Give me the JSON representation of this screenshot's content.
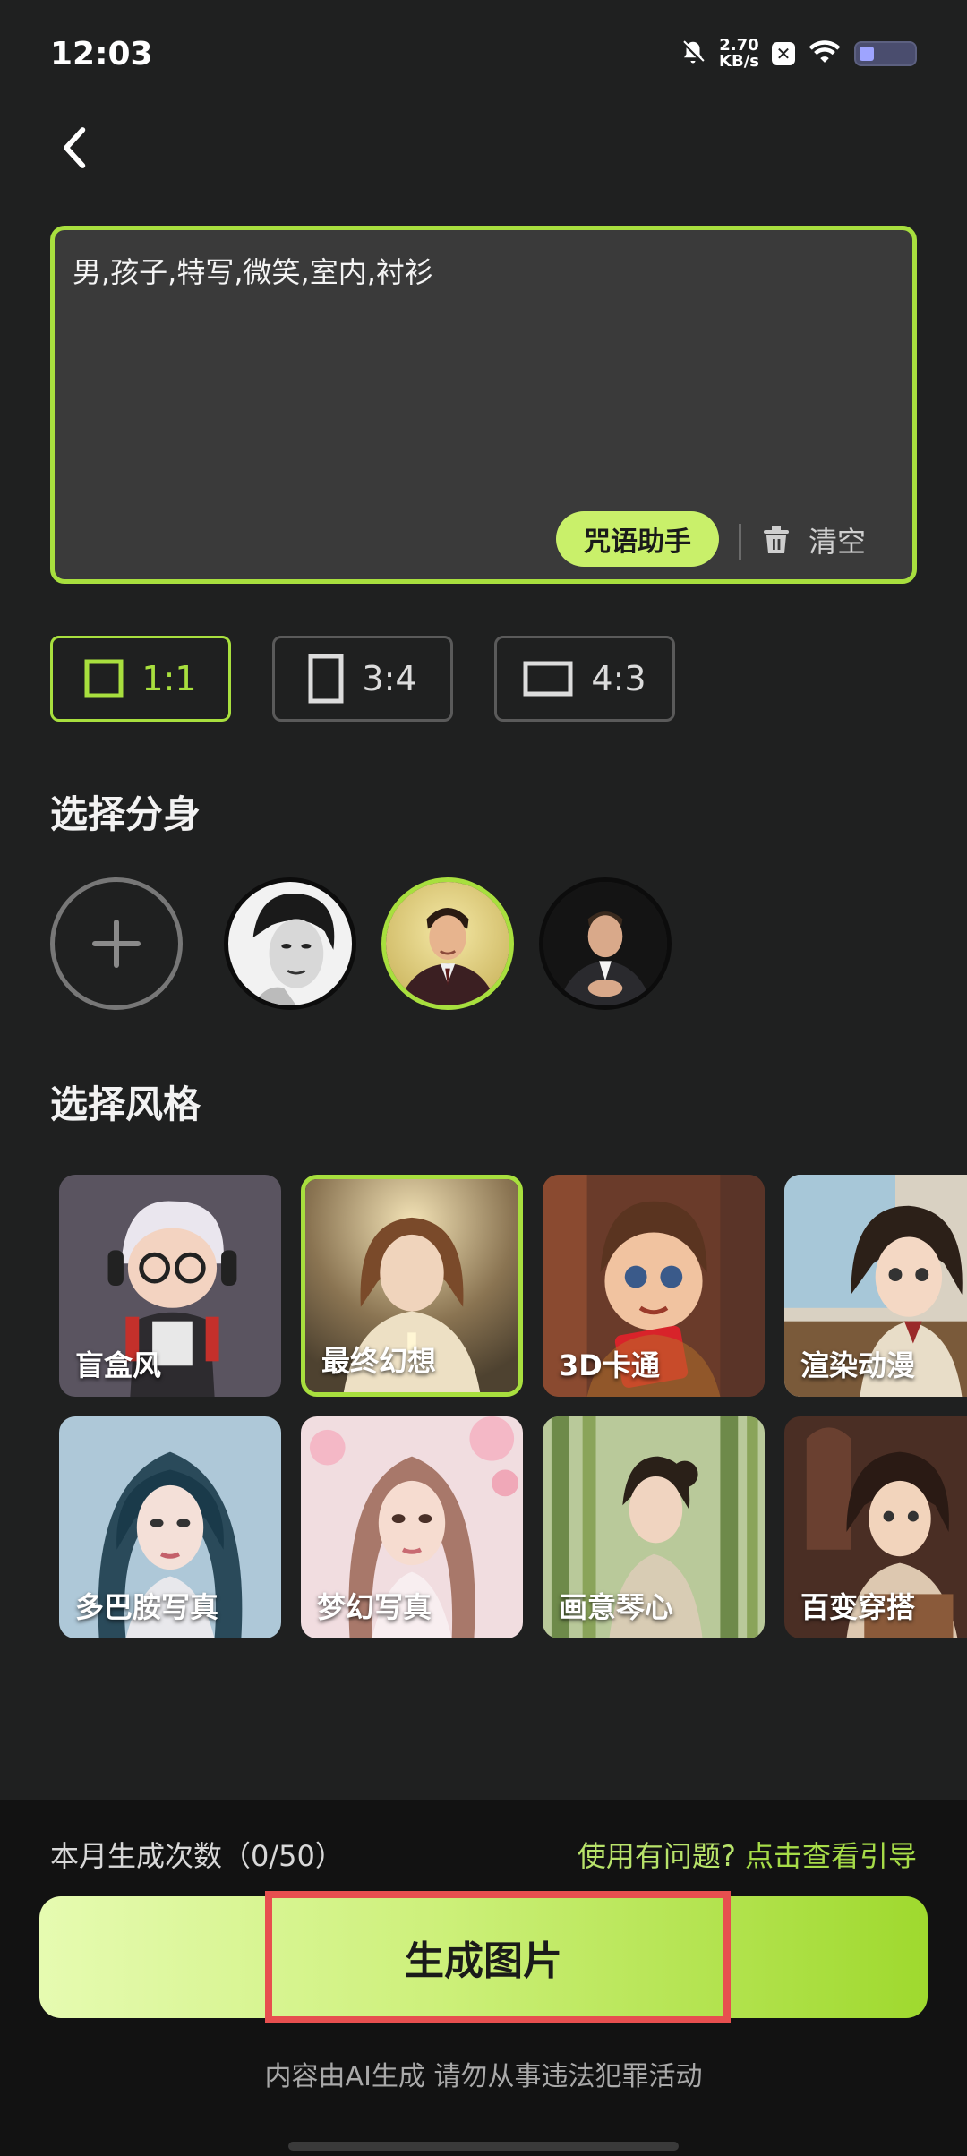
{
  "status": {
    "time": "12:03",
    "speed_value": "2.70",
    "speed_unit": "KB/s",
    "icons": [
      "mute-bell-icon",
      "x-app-icon",
      "wifi-icon",
      "battery-icon"
    ]
  },
  "nav": {
    "back_icon": "chevron-left-icon"
  },
  "prompt": {
    "text": "男,孩子,特写,微笑,室内,衬衫",
    "assist_label": "咒语助手",
    "clear_label": "清空"
  },
  "ratios": [
    {
      "label": "1:1",
      "active": true
    },
    {
      "label": "3:4",
      "active": false
    },
    {
      "label": "4:3",
      "active": false
    }
  ],
  "avatars": {
    "title": "选择分身",
    "add_icon": "plus-icon",
    "selected_index": 1
  },
  "styles": {
    "title": "选择风格",
    "items": [
      {
        "label": "盲盒风"
      },
      {
        "label": "最终幻想",
        "selected": true
      },
      {
        "label": "3D卡通"
      },
      {
        "label": "渲染动漫"
      },
      {
        "label": "多巴胺写真"
      },
      {
        "label": "梦幻写真"
      },
      {
        "label": "画意琴心"
      },
      {
        "label": "百变穿搭"
      }
    ]
  },
  "footer": {
    "usage": "本月生成次数（0/50）",
    "help_question": "使用有问题?",
    "help_link": "点击查看引导",
    "generate_label": "生成图片",
    "disclaimer": "内容由AI生成 请勿从事违法犯罪活动"
  },
  "colors": {
    "accent": "#a8df3e",
    "background": "#1f2020",
    "highlight": "#e74f4f"
  }
}
